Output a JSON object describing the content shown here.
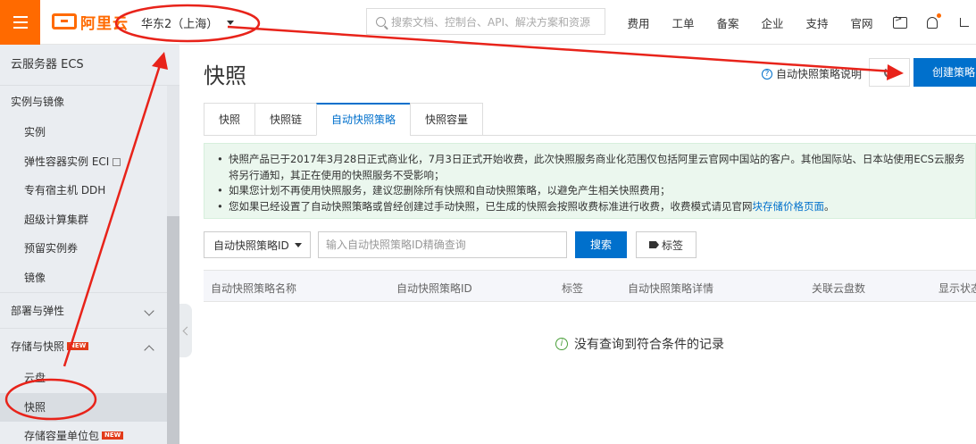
{
  "topbar": {
    "logo_text": "阿里云",
    "region": "华东2（上海）",
    "search_placeholder": "搜索文档、控制台、API、解决方案和资源",
    "nav": [
      "费用",
      "工单",
      "备案",
      "企业",
      "支持",
      "官网"
    ]
  },
  "sidebar": {
    "title": "云服务器 ECS",
    "group_instances": "实例与镜像",
    "items_instances": [
      "实例",
      "弹性容器实例 ECI",
      "专有宿主机 DDH",
      "超级计算集群",
      "预留实例券",
      "镜像"
    ],
    "group_deploy": "部署与弹性",
    "group_storage": "存储与快照",
    "new_badge": "NEW",
    "items_storage": [
      "云盘",
      "快照",
      "存储容量单位包"
    ]
  },
  "main": {
    "title": "快照",
    "help_link": "自动快照策略说明",
    "create_button": "创建策略",
    "tabs": [
      "快照",
      "快照链",
      "自动快照策略",
      "快照容量"
    ],
    "active_tab": 2,
    "notice": {
      "line1": "快照产品已于2017年3月28日正式商业化，7月3日正式开始收费，此次快照服务商业化范围仅包括阿里云官网中国站的客户。其他国际站、日本站使用ECS云服务",
      "line1_cont": "将另行通知，其正在使用的快照服务不受影响；",
      "line2": "如果您计划不再使用快照服务，建议您删除所有快照和自动快照策略，以避免产生相关快照费用；",
      "line3": "您如果已经设置了自动快照策略或曾经创建过手动快照，已生成的快照会按照收费标准进行收费，收费模式请见官网",
      "line3_link": "块存储价格页面",
      "line3_end": "。"
    },
    "filter": {
      "select_value": "自动快照策略ID",
      "input_placeholder": "输入自动快照策略ID精确查询",
      "search_button": "搜索",
      "tag_button": "标签"
    },
    "table": {
      "columns": [
        "自动快照策略名称",
        "自动快照策略ID",
        "标签",
        "自动快照策略详情",
        "关联云盘数",
        "显示状态"
      ]
    },
    "empty_text": "没有查询到符合条件的记录"
  },
  "colors": {
    "brand_orange": "#ff6a00",
    "primary_blue": "#0070cc",
    "annotation_red": "#e8231a",
    "notice_bg": "#ebf7ee"
  }
}
